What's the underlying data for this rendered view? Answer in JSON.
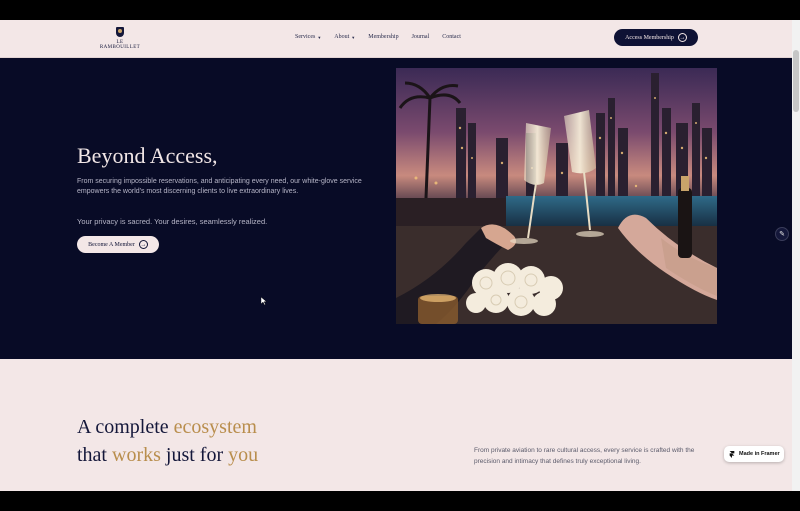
{
  "brand": {
    "logo_text": "LE RAMBOUILLET"
  },
  "nav": {
    "items": [
      {
        "label": "Services",
        "dropdown": true
      },
      {
        "label": "About",
        "dropdown": true
      },
      {
        "label": "Membership",
        "dropdown": false
      },
      {
        "label": "Journal",
        "dropdown": false
      },
      {
        "label": "Contact",
        "dropdown": false
      }
    ],
    "cta_label": "Access Membership"
  },
  "hero": {
    "title": "Beyond Access,",
    "description": "From securing impossible reservations, and anticipating every need, our white-glove service empowers the world's most discerning clients to live extraordinary lives.",
    "privacy": "Your privacy is sacred. Your desires, seamlessly realized.",
    "button_label": "Become A Member",
    "image_icon": "champagne-toast-photo"
  },
  "ecosystem": {
    "heading_line1_a": "A complete ",
    "heading_line1_b": "ecosystem",
    "heading_line2_a": "that ",
    "heading_line2_b": "works",
    "heading_line2_c": " just for ",
    "heading_line2_d": "you",
    "text": "From private aviation to rare cultural access, every service is crafted with the precision and intimacy that defines truly exceptional living."
  },
  "badge": {
    "label": "Made in Framer",
    "icon": "framer-icon"
  },
  "colors": {
    "navy": "#080b26",
    "cream": "#f3e7e7",
    "gold": "#b98e4d"
  }
}
